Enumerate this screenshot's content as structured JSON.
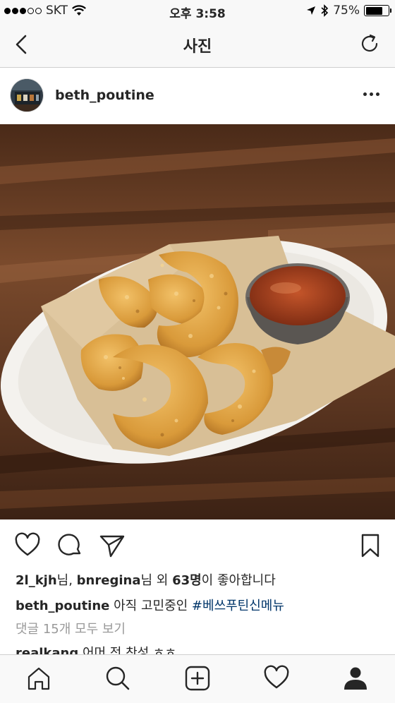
{
  "status_bar": {
    "carrier": "SKT",
    "time": "오후 3:58",
    "battery": "75%",
    "battery_level": 0.75,
    "signal_dots_filled": 3,
    "signal_dots_total": 5
  },
  "nav": {
    "title": "사진"
  },
  "post": {
    "username": "beth_poutine",
    "likes": {
      "user1": "2l_kjh",
      "suffix1": "님, ",
      "user2": "bnregina",
      "suffix2": "님 외 ",
      "count": "63명",
      "tail": "이 좋아합니다"
    },
    "caption": {
      "username": "beth_poutine",
      "text": "아직 고민중인 ",
      "hashtag": "#베쓰푸틴신메뉴"
    },
    "view_comments": "댓글 15개 모두 보기",
    "comment": {
      "username": "realkang",
      "text": "어머 전 찬성 ㅎㅎ"
    }
  },
  "icons": {
    "back": "chevron-left-icon",
    "refresh": "refresh-icon",
    "more": "more-horizontal-icon",
    "like": "heart-icon",
    "comment": "comment-icon",
    "share": "send-icon",
    "save": "bookmark-icon",
    "home": "home-icon",
    "search": "search-icon",
    "add": "add-post-icon",
    "activity": "heart-icon",
    "profile": "profile-icon"
  },
  "colors": {
    "hashtag": "#003569",
    "muted": "#999999",
    "text": "#262626"
  }
}
